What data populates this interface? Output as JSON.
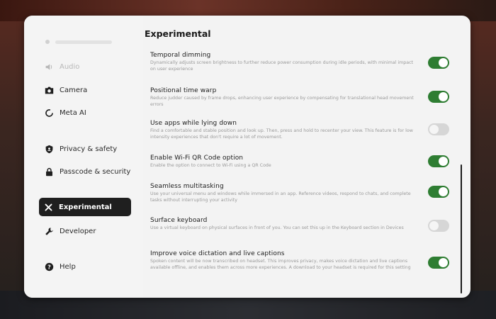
{
  "sidebar": {
    "items": [
      {
        "label": "Audio",
        "icon": "speaker-icon"
      },
      {
        "label": "Camera",
        "icon": "camera-icon"
      },
      {
        "label": "Meta AI",
        "icon": "meta-ai-icon"
      },
      {
        "label": "Privacy & safety",
        "icon": "shield-icon"
      },
      {
        "label": "Passcode & security",
        "icon": "lock-icon"
      },
      {
        "label": "Experimental",
        "icon": "experimental-icon"
      },
      {
        "label": "Developer",
        "icon": "wrench-icon"
      },
      {
        "label": "Help",
        "icon": "help-icon"
      }
    ]
  },
  "main": {
    "title": "Experimental",
    "settings": [
      {
        "name": "Temporal dimming",
        "desc": "Dynamically adjusts screen brightness to further reduce power consumption during idle periods, with minimal impact on user experience",
        "enabled": true
      },
      {
        "name": "Positional time warp",
        "desc": "Reduce judder caused by frame drops, enhancing user experience by compensating for translational head movement errors",
        "enabled": true
      },
      {
        "name": "Use apps while lying down",
        "desc": "Find a comfortable and stable position and look up. Then, press and hold to recenter your view. This feature is for low intensity experiences that don't require a lot of movement.",
        "enabled": false
      },
      {
        "name": "Enable Wi-Fi QR Code option",
        "desc": "Enable the option to connect to Wi-Fi using a QR Code",
        "enabled": true
      },
      {
        "name": "Seamless multitasking",
        "desc": "Use your universal menu and windows while immersed in an app. Reference videos, respond to chats, and complete tasks without interrupting your activity",
        "enabled": true
      },
      {
        "name": "Surface keyboard",
        "desc": "Use a virtual keyboard on physical surfaces in front of you. You can set this up in the Keyboard section in Devices",
        "enabled": false
      },
      {
        "name": "Improve voice dictation and live captions",
        "desc": "Spoken content will be now transcribed on headset. This improves privacy, makes voice dictation and live captions available offline, and enables them across more experiences. A download to your headset is required for this setting",
        "enabled": true
      }
    ]
  },
  "colors": {
    "toggle_on": "#2e7d32",
    "toggle_off": "#d6d6d6",
    "active_item_bg": "#1f1f1f"
  }
}
